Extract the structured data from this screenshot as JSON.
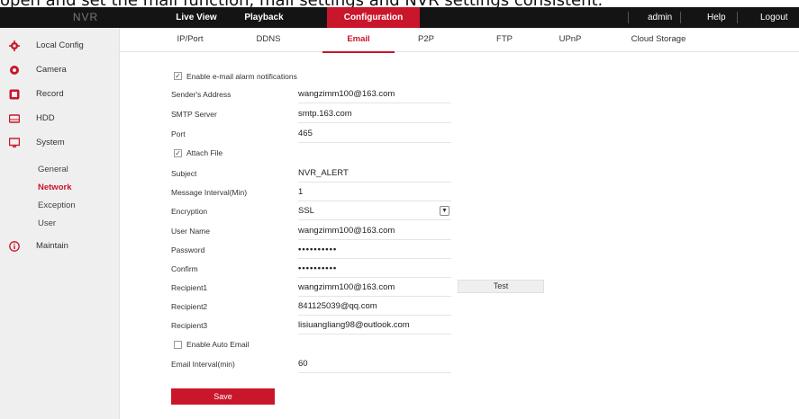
{
  "caption": "open and set the mail function, mail settings and NVR settings consistent.",
  "topbar": {
    "brand": "NVR",
    "tabs": [
      "Live View",
      "Playback",
      "Configuration"
    ],
    "active_tab": "Configuration",
    "user": "admin",
    "help": "Help",
    "logout": "Logout"
  },
  "sidebar": {
    "items": [
      {
        "label": "Local Config",
        "icon": "gear-icon"
      },
      {
        "label": "Camera",
        "icon": "camera-icon"
      },
      {
        "label": "Record",
        "icon": "record-icon"
      },
      {
        "label": "HDD",
        "icon": "hdd-icon"
      },
      {
        "label": "System",
        "icon": "monitor-icon"
      },
      {
        "label": "Maintain",
        "icon": "info-icon"
      }
    ],
    "system_sub": [
      "General",
      "Network",
      "Exception",
      "User"
    ],
    "active_sub": "Network"
  },
  "subtabs": [
    "IP/Port",
    "DDNS",
    "Email",
    "P2P",
    "FTP",
    "UPnP",
    "Cloud Storage"
  ],
  "active_subtab": "Email",
  "form": {
    "enable_alarm_label": "Enable e-mail alarm notifications",
    "enable_alarm_checked": true,
    "sender_label": "Sender's Address",
    "sender_value": "wangzimm100@163.com",
    "smtp_label": "SMTP Server",
    "smtp_value": "smtp.163.com",
    "port_label": "Port",
    "port_value": "465",
    "attach_label": "Attach File",
    "attach_checked": true,
    "subject_label": "Subject",
    "subject_value": "NVR_ALERT",
    "interval_label": "Message Interval(Min)",
    "interval_value": "1",
    "encryption_label": "Encryption",
    "encryption_value": "SSL",
    "username_label": "User Name",
    "username_value": "wangzimm100@163.com",
    "password_label": "Password",
    "password_value": "••••••••••",
    "confirm_label": "Confirm",
    "confirm_value": "••••••••••",
    "recipient1_label": "Recipient1",
    "recipient1_value": "wangzimm100@163.com",
    "test_label": "Test",
    "recipient2_label": "Recipient2",
    "recipient2_value": "841125039@qq.com",
    "recipient3_label": "Recipient3",
    "recipient3_value": "lisiuangliang98@outlook.com",
    "auto_email_label": "Enable Auto Email",
    "auto_email_checked": false,
    "email_interval_label": "Email Interval(min)",
    "email_interval_value": "60",
    "save_label": "Save"
  },
  "colors": {
    "accent": "#c9162b",
    "topbar": "#141414",
    "sidebar": "#efefef"
  }
}
